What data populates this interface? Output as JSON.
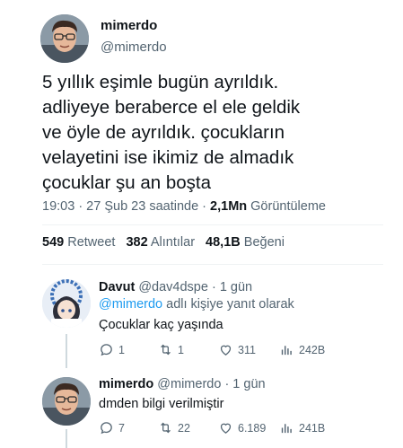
{
  "main_tweet": {
    "author_name": "mimerdo",
    "author_handle": "@mimerdo",
    "text_lines": [
      "5 yıllık eşimle bugün ayrıldık.",
      "adliyeye beraberce el ele geldik",
      "ve öyle de ayrıldık. çocukların",
      "velayetini ise ikimiz de almadık",
      "çocuklar şu an boşta"
    ],
    "meta_time": "19:03 · 27 Şub 23 saatinde · ",
    "meta_views_count": "2,1Mn",
    "meta_views_label": " Görüntüleme",
    "stats": {
      "retweets_count": "549",
      "retweets_label": "Retweet",
      "quotes_count": "382",
      "quotes_label": "Alıntılar",
      "likes_count": "48,1B",
      "likes_label": "Beğeni"
    }
  },
  "replies": [
    {
      "author_name": "Davut",
      "author_handle": "@dav4dspe",
      "time": "· 1 gün",
      "replying_mention": "@mimerdo",
      "replying_suffix": " adlı kişiye yanıt olarak",
      "text": "Çocuklar kaç yaşında",
      "reply_count": "1",
      "retweet_count": "1",
      "like_count": "311",
      "view_count": "242B"
    },
    {
      "author_name": "mimerdo",
      "author_handle": "@mimerdo",
      "time": "· 1 gün",
      "text": "dmden bilgi verilmiştir",
      "reply_count": "7",
      "retweet_count": "22",
      "like_count": "6.189",
      "view_count": "241B"
    }
  ],
  "colors": {
    "text_primary": "#0f1419",
    "text_secondary": "#536471",
    "link": "#1d9bf0",
    "divider": "#eff3f4"
  },
  "icons": [
    "reply-icon",
    "retweet-icon",
    "like-icon",
    "views-icon"
  ]
}
